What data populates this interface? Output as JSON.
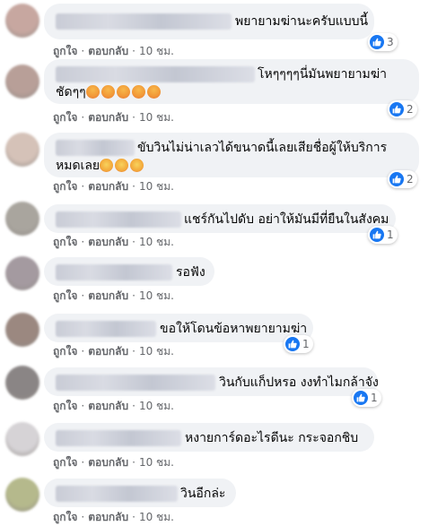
{
  "comments": [
    {
      "text": "พยายามฆ่านะครับแบบนี้",
      "likes": "3",
      "avatar_color": "#c7a7a0"
    },
    {
      "text": "โหๆๆๆๆนี่มันพยายามฆ่า",
      "text2": "ชัดๆๆ",
      "emojis": [
        "angry",
        "angry",
        "angry",
        "angry",
        "angry"
      ],
      "likes": "2",
      "avatar_color": "#b89f98"
    },
    {
      "text": "ขับวินไม่น่าเลวได้ขนาดนี้เลยเสียชื่อผู้ให้บริการ",
      "text2": "หมดเลย",
      "emojis": [
        "cry",
        "cry",
        "cry"
      ],
      "likes": "2",
      "avatar_color": "#d5c2b8"
    },
    {
      "text": "แชร์กันไปดับ อย่าให้มันมีที่ยืนในสังคม",
      "likes": "1",
      "avatar_color": "#a9a59e"
    },
    {
      "text": "รอฟัง",
      "likes": "",
      "avatar_color": "#a49aa0"
    },
    {
      "text": "ขอให้โดนข้อหาพยายามฆ่า",
      "likes": "1",
      "avatar_color": "#9b8880"
    },
    {
      "text": "วินกับแก็ปหรอ งงทำไมกล้าจัง",
      "likes": "1",
      "avatar_color": "#8a8585"
    },
    {
      "text": "หงายการ์ดอะไรดีนะ กระจอกชิบ",
      "likes": "",
      "avatar_color": "#d6d3d6"
    },
    {
      "text": "วินอีกล่ะ",
      "likes": "",
      "avatar_color": "#b5b98c"
    }
  ],
  "actions": {
    "like": "ถูกใจ",
    "reply": "ตอบกลับ",
    "time": "10 ชม.",
    "dot": "·"
  },
  "colors": {
    "like_blue": "#1877f2",
    "bubble": "#f0f2f5",
    "meta": "#65676b"
  }
}
